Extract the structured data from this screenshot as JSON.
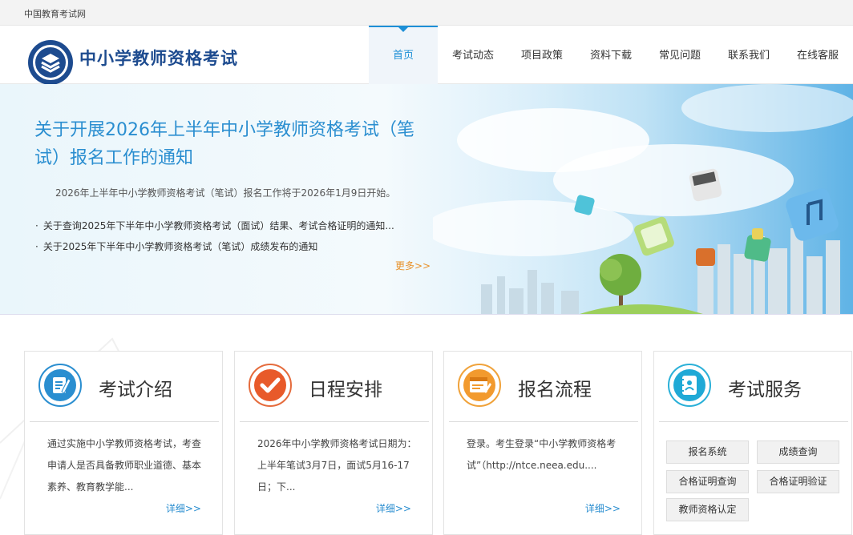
{
  "topbar": {
    "site_link": "中国教育考试网"
  },
  "header": {
    "title": "中小学教师资格考试"
  },
  "nav": [
    {
      "label": "首页",
      "active": true
    },
    {
      "label": "考试动态"
    },
    {
      "label": "项目政策"
    },
    {
      "label": "资料下载"
    },
    {
      "label": "常见问题"
    },
    {
      "label": "联系我们"
    },
    {
      "label": "在线客服"
    }
  ],
  "banner": {
    "headline": "关于开展2026年上半年中小学教师资格考试（笔试）报名工作的通知",
    "summary": "2026年上半年中小学教师资格考试（笔试）报名工作将于2026年1月9日开始。",
    "news": [
      "关于查询2025年下半年中小学教师资格考试（面试）结果、考试合格证明的通知...",
      "关于2025年下半年中小学教师资格考试（笔试）成绩发布的通知"
    ],
    "more": "更多>>"
  },
  "cards": [
    {
      "title": "考试介绍",
      "icon": "document-edit-icon",
      "text": "通过实施中小学教师资格考试，考查申请人是否具备教师职业道德、基本素养、教育教学能...",
      "more": "详细>>"
    },
    {
      "title": "日程安排",
      "icon": "checkmark-icon",
      "text": "2026年中小学教师资格考试日期为：上半年笔试3月7日，面试5月16-17日；下...",
      "more": "详细>>"
    },
    {
      "title": "报名流程",
      "icon": "form-icon",
      "text": "登录。考生登录“中小学教师资格考试”（http://ntce.neea.edu....",
      "more": "详细>>"
    },
    {
      "title": "考试服务",
      "icon": "contact-book-icon"
    }
  ],
  "services": [
    "报名系统",
    "成绩查询",
    "合格证明查询",
    "合格证明验证",
    "教师资格认定"
  ],
  "colors": {
    "brand": "#1d4b8f",
    "accent": "#2a8ed0",
    "more": "#e8922b"
  }
}
